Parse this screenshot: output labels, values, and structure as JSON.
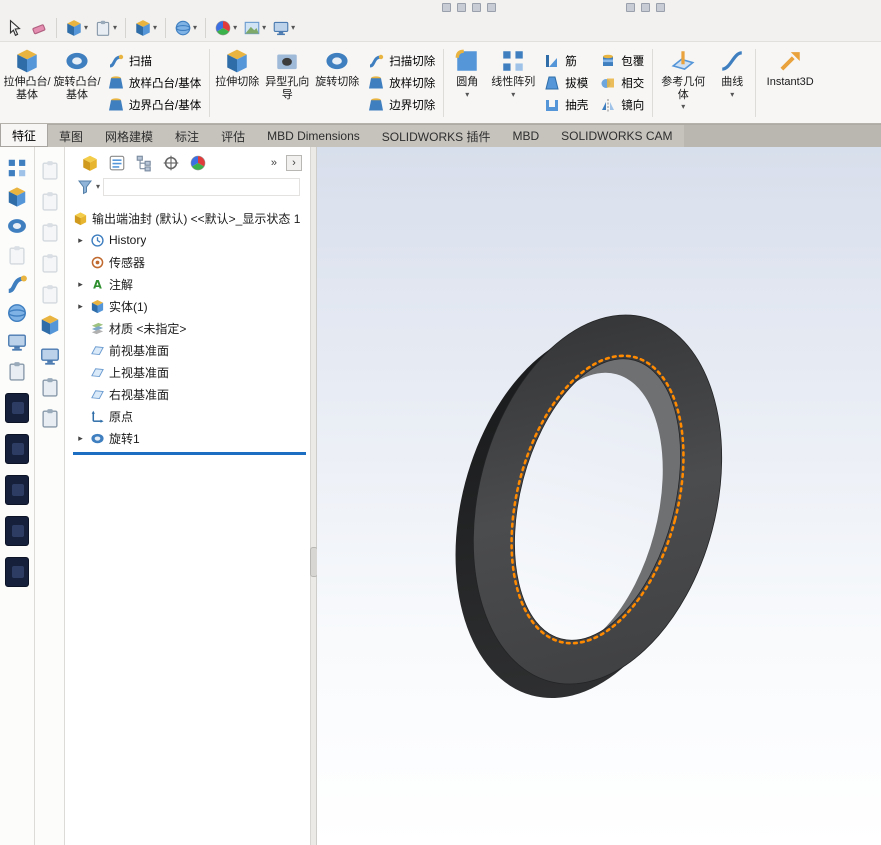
{
  "icons": {
    "expand_arrow": "▸",
    "dropdown_arrow": "▾",
    "chevron_right": "›",
    "chevron_double": "»"
  },
  "ribbon": {
    "extrude_boss": "拉伸凸台/基体",
    "revolve_boss": "旋转凸台/基体",
    "sweep": "扫描",
    "loft": "放样凸台/基体",
    "boundary": "边界凸台/基体",
    "extrude_cut": "拉伸切除",
    "hole_wizard": "异型孔向导",
    "revolve_cut": "旋转切除",
    "sweep_cut": "扫描切除",
    "loft_cut": "放样切除",
    "boundary_cut": "边界切除",
    "fillet": "圆角",
    "linear_pattern": "线性阵列",
    "rib": "筋",
    "draft": "拔模",
    "shell": "抽壳",
    "wrap": "包覆",
    "intersect": "相交",
    "mirror": "镜向",
    "ref_geometry": "参考几何体",
    "curves": "曲线",
    "instant3d": "Instant3D"
  },
  "tabs": {
    "items": [
      {
        "label": "特征",
        "active": true
      },
      {
        "label": "草图",
        "active": false
      },
      {
        "label": "网格建模",
        "active": false
      },
      {
        "label": "标注",
        "active": false
      },
      {
        "label": "评估",
        "active": false
      },
      {
        "label": "MBD Dimensions",
        "active": false
      },
      {
        "label": "SOLIDWORKS 插件",
        "active": false
      },
      {
        "label": "MBD",
        "active": false
      },
      {
        "label": "SOLIDWORKS CAM",
        "active": false
      }
    ]
  },
  "feature_tree": {
    "root_label": "输出端油封 (默认) <<默认>_显示状态 1",
    "items": [
      {
        "label": "History"
      },
      {
        "label": "传感器"
      },
      {
        "label": "注解"
      },
      {
        "label": "实体(1)"
      },
      {
        "label": "材质 <未指定>"
      },
      {
        "label": "前视基准面"
      },
      {
        "label": "上视基准面"
      },
      {
        "label": "右视基准面"
      },
      {
        "label": "原点"
      },
      {
        "label": "旋转1"
      }
    ]
  },
  "viewport": {
    "model": "输出端油封 (oil seal ring)",
    "sketch_color": "#ff8a00",
    "body_face_color": "#47484a",
    "body_side_color": "#272829",
    "background_top": "#d8dfec",
    "background_bottom": "#ffffff"
  }
}
